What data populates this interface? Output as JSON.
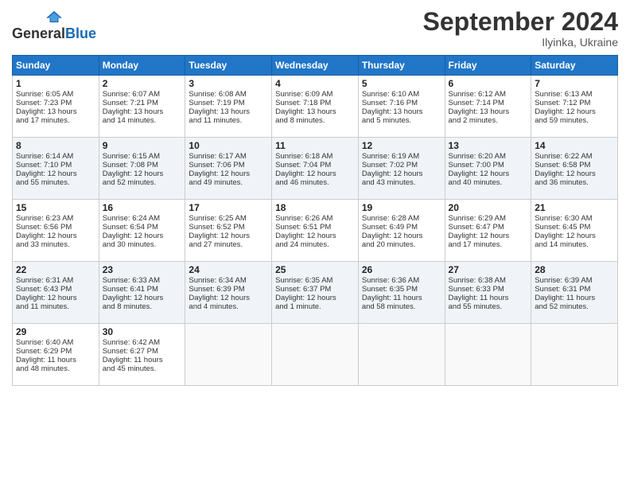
{
  "header": {
    "logo_general": "General",
    "logo_blue": "Blue",
    "month_title": "September 2024",
    "location": "Ilyinka, Ukraine"
  },
  "days_of_week": [
    "Sunday",
    "Monday",
    "Tuesday",
    "Wednesday",
    "Thursday",
    "Friday",
    "Saturday"
  ],
  "weeks": [
    [
      {
        "day": 1,
        "info": [
          "Sunrise: 6:05 AM",
          "Sunset: 7:23 PM",
          "Daylight: 13 hours",
          "and 17 minutes."
        ]
      },
      {
        "day": 2,
        "info": [
          "Sunrise: 6:07 AM",
          "Sunset: 7:21 PM",
          "Daylight: 13 hours",
          "and 14 minutes."
        ]
      },
      {
        "day": 3,
        "info": [
          "Sunrise: 6:08 AM",
          "Sunset: 7:19 PM",
          "Daylight: 13 hours",
          "and 11 minutes."
        ]
      },
      {
        "day": 4,
        "info": [
          "Sunrise: 6:09 AM",
          "Sunset: 7:18 PM",
          "Daylight: 13 hours",
          "and 8 minutes."
        ]
      },
      {
        "day": 5,
        "info": [
          "Sunrise: 6:10 AM",
          "Sunset: 7:16 PM",
          "Daylight: 13 hours",
          "and 5 minutes."
        ]
      },
      {
        "day": 6,
        "info": [
          "Sunrise: 6:12 AM",
          "Sunset: 7:14 PM",
          "Daylight: 13 hours",
          "and 2 minutes."
        ]
      },
      {
        "day": 7,
        "info": [
          "Sunrise: 6:13 AM",
          "Sunset: 7:12 PM",
          "Daylight: 12 hours",
          "and 59 minutes."
        ]
      }
    ],
    [
      {
        "day": 8,
        "info": [
          "Sunrise: 6:14 AM",
          "Sunset: 7:10 PM",
          "Daylight: 12 hours",
          "and 55 minutes."
        ]
      },
      {
        "day": 9,
        "info": [
          "Sunrise: 6:15 AM",
          "Sunset: 7:08 PM",
          "Daylight: 12 hours",
          "and 52 minutes."
        ]
      },
      {
        "day": 10,
        "info": [
          "Sunrise: 6:17 AM",
          "Sunset: 7:06 PM",
          "Daylight: 12 hours",
          "and 49 minutes."
        ]
      },
      {
        "day": 11,
        "info": [
          "Sunrise: 6:18 AM",
          "Sunset: 7:04 PM",
          "Daylight: 12 hours",
          "and 46 minutes."
        ]
      },
      {
        "day": 12,
        "info": [
          "Sunrise: 6:19 AM",
          "Sunset: 7:02 PM",
          "Daylight: 12 hours",
          "and 43 minutes."
        ]
      },
      {
        "day": 13,
        "info": [
          "Sunrise: 6:20 AM",
          "Sunset: 7:00 PM",
          "Daylight: 12 hours",
          "and 40 minutes."
        ]
      },
      {
        "day": 14,
        "info": [
          "Sunrise: 6:22 AM",
          "Sunset: 6:58 PM",
          "Daylight: 12 hours",
          "and 36 minutes."
        ]
      }
    ],
    [
      {
        "day": 15,
        "info": [
          "Sunrise: 6:23 AM",
          "Sunset: 6:56 PM",
          "Daylight: 12 hours",
          "and 33 minutes."
        ]
      },
      {
        "day": 16,
        "info": [
          "Sunrise: 6:24 AM",
          "Sunset: 6:54 PM",
          "Daylight: 12 hours",
          "and 30 minutes."
        ]
      },
      {
        "day": 17,
        "info": [
          "Sunrise: 6:25 AM",
          "Sunset: 6:52 PM",
          "Daylight: 12 hours",
          "and 27 minutes."
        ]
      },
      {
        "day": 18,
        "info": [
          "Sunrise: 6:26 AM",
          "Sunset: 6:51 PM",
          "Daylight: 12 hours",
          "and 24 minutes."
        ]
      },
      {
        "day": 19,
        "info": [
          "Sunrise: 6:28 AM",
          "Sunset: 6:49 PM",
          "Daylight: 12 hours",
          "and 20 minutes."
        ]
      },
      {
        "day": 20,
        "info": [
          "Sunrise: 6:29 AM",
          "Sunset: 6:47 PM",
          "Daylight: 12 hours",
          "and 17 minutes."
        ]
      },
      {
        "day": 21,
        "info": [
          "Sunrise: 6:30 AM",
          "Sunset: 6:45 PM",
          "Daylight: 12 hours",
          "and 14 minutes."
        ]
      }
    ],
    [
      {
        "day": 22,
        "info": [
          "Sunrise: 6:31 AM",
          "Sunset: 6:43 PM",
          "Daylight: 12 hours",
          "and 11 minutes."
        ]
      },
      {
        "day": 23,
        "info": [
          "Sunrise: 6:33 AM",
          "Sunset: 6:41 PM",
          "Daylight: 12 hours",
          "and 8 minutes."
        ]
      },
      {
        "day": 24,
        "info": [
          "Sunrise: 6:34 AM",
          "Sunset: 6:39 PM",
          "Daylight: 12 hours",
          "and 4 minutes."
        ]
      },
      {
        "day": 25,
        "info": [
          "Sunrise: 6:35 AM",
          "Sunset: 6:37 PM",
          "Daylight: 12 hours",
          "and 1 minute."
        ]
      },
      {
        "day": 26,
        "info": [
          "Sunrise: 6:36 AM",
          "Sunset: 6:35 PM",
          "Daylight: 11 hours",
          "and 58 minutes."
        ]
      },
      {
        "day": 27,
        "info": [
          "Sunrise: 6:38 AM",
          "Sunset: 6:33 PM",
          "Daylight: 11 hours",
          "and 55 minutes."
        ]
      },
      {
        "day": 28,
        "info": [
          "Sunrise: 6:39 AM",
          "Sunset: 6:31 PM",
          "Daylight: 11 hours",
          "and 52 minutes."
        ]
      }
    ],
    [
      {
        "day": 29,
        "info": [
          "Sunrise: 6:40 AM",
          "Sunset: 6:29 PM",
          "Daylight: 11 hours",
          "and 48 minutes."
        ]
      },
      {
        "day": 30,
        "info": [
          "Sunrise: 6:42 AM",
          "Sunset: 6:27 PM",
          "Daylight: 11 hours",
          "and 45 minutes."
        ]
      },
      null,
      null,
      null,
      null,
      null
    ]
  ]
}
